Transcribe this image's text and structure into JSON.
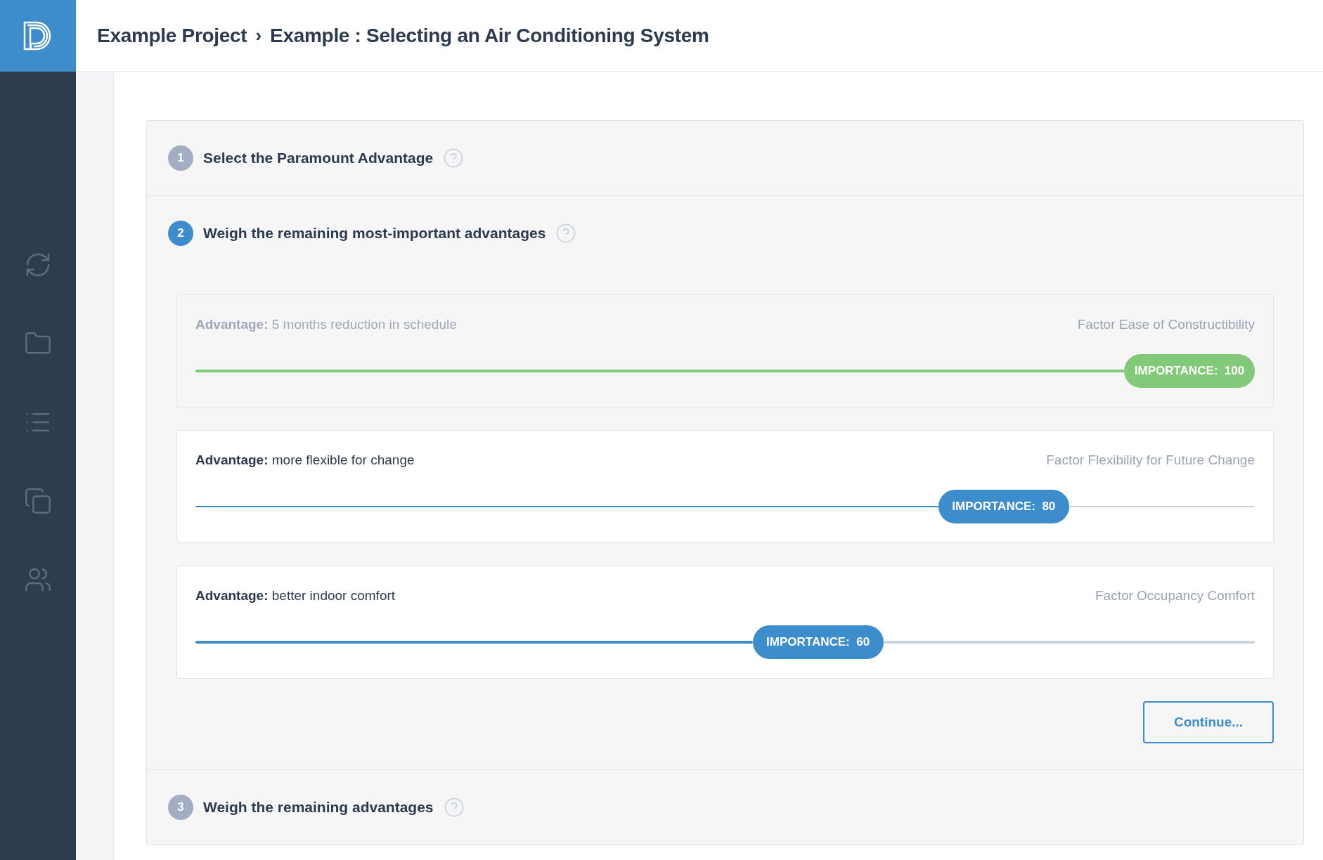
{
  "header": {
    "breadcrumb": [
      "Example Project",
      "Example : Selecting an Air Conditioning System"
    ],
    "separator": "›"
  },
  "sidebar": {
    "items": [
      {
        "kind": "sync"
      },
      {
        "kind": "folder"
      },
      {
        "kind": "list"
      },
      {
        "kind": "copy"
      },
      {
        "kind": "users"
      }
    ]
  },
  "steps": [
    {
      "number": "1",
      "title": "Select the Paramount Advantage",
      "active": false
    },
    {
      "number": "2",
      "title": "Weigh the remaining most-important advantages",
      "active": true,
      "advantages": [
        {
          "label": "Advantage:",
          "text": "5 months reduction in schedule",
          "factor": "Factor Ease of Constructibility",
          "importance": "IMPORTANCE:  100",
          "level": 1,
          "disabled": true,
          "focused": true
        },
        {
          "label": "Advantage:",
          "text": "more flexible for change",
          "factor": "Factor Flexibility for Future Change",
          "importance": "IMPORTANCE:  80",
          "level": 0.8,
          "disabled": false,
          "focused": false
        },
        {
          "label": "Advantage:",
          "text": "better indoor comfort",
          "factor": "Factor Occupancy Comfort",
          "importance": "IMPORTANCE:  60",
          "level": 0.6,
          "disabled": false,
          "focused": true
        }
      ],
      "button": "Continue..."
    },
    {
      "number": "3",
      "title": "Weigh the remaining advantages",
      "active": false
    }
  ]
}
